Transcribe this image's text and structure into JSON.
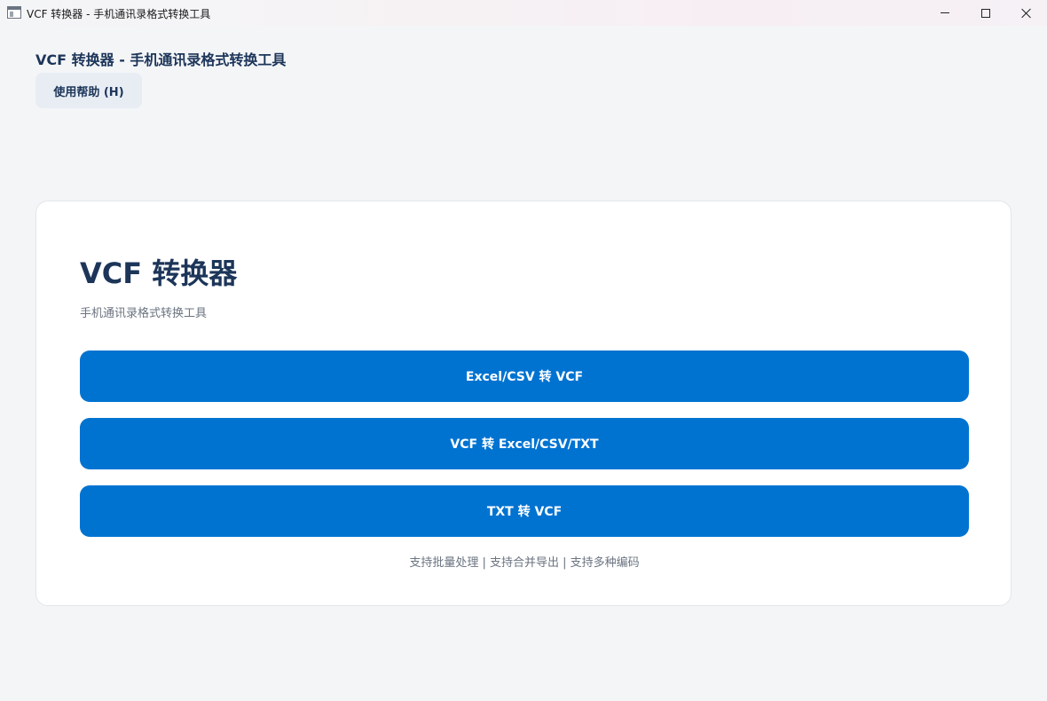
{
  "window": {
    "title": "VCF 转换器 - 手机通讯录格式转换工具",
    "icon": "app-window-icon",
    "controls": [
      "minimize-icon",
      "maximize-icon",
      "close-icon"
    ]
  },
  "header": {
    "title": "VCF 转换器 - 手机通讯录格式转换工具",
    "help_label": "使用帮助 (H)"
  },
  "main": {
    "title": "VCF 转换器",
    "subtitle": "手机通讯录格式转换工具",
    "buttons": [
      {
        "label": "Excel/CSV 转 VCF"
      },
      {
        "label": "VCF 转 Excel/CSV/TXT"
      },
      {
        "label": "TXT 转 VCF"
      }
    ],
    "features": "支持批量处理 | 支持合并导出 | 支持多种编码"
  },
  "colors": {
    "accent": "#0073d1",
    "heading": "#1c3559",
    "muted": "#6a7380",
    "background": "#f4f5f7",
    "card": "#ffffff",
    "help_button_bg": "#e8edf4"
  }
}
